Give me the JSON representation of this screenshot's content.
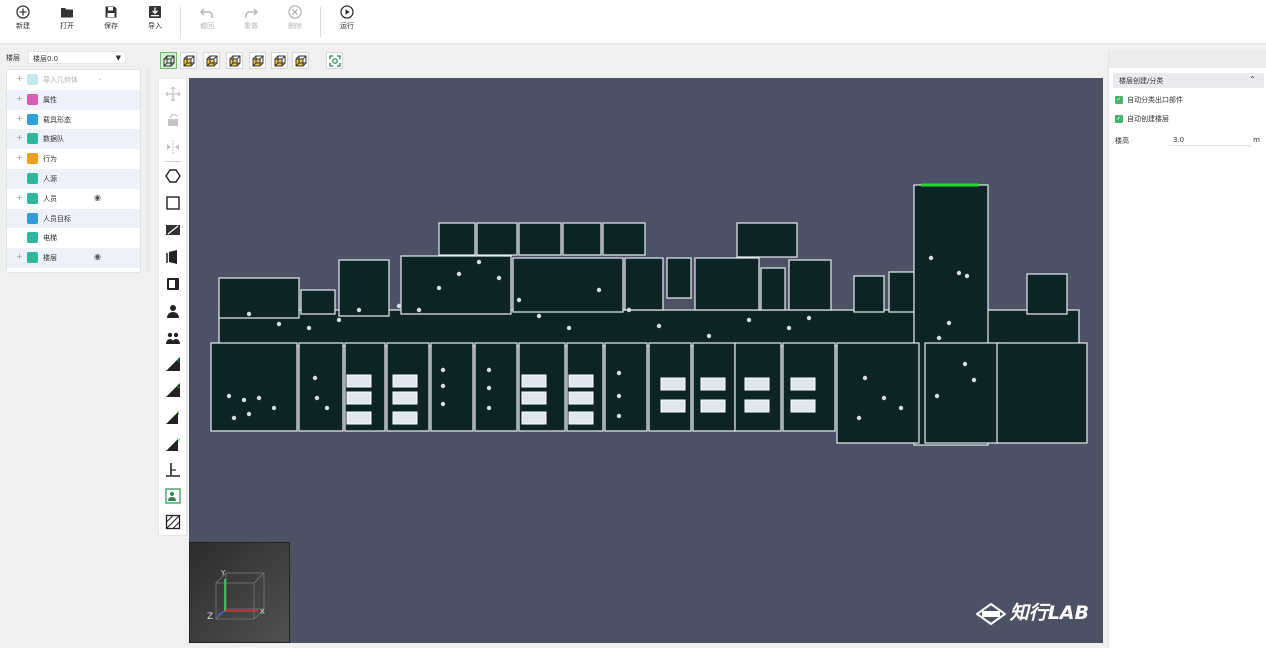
{
  "toolbar": {
    "new": {
      "label": "新建",
      "icon": "plus-circle-icon"
    },
    "open": {
      "label": "打开",
      "icon": "folder-icon"
    },
    "save": {
      "label": "保存",
      "icon": "floppy-icon"
    },
    "import": {
      "label": "导入",
      "icon": "import-icon"
    },
    "undo": {
      "label": "撤回",
      "icon": "undo-icon",
      "enabled": false
    },
    "redo": {
      "label": "重做",
      "icon": "redo-icon",
      "enabled": false
    },
    "delete": {
      "label": "删除",
      "icon": "delete-icon",
      "enabled": false
    },
    "run": {
      "label": "运行",
      "icon": "play-circle-icon"
    }
  },
  "floor": {
    "label": "楼层",
    "selected": "楼层0.0"
  },
  "tree": {
    "items": [
      {
        "label": "导入几何体",
        "icon": "geometry-icon",
        "color": "#6fc4d8",
        "expandable": true,
        "dimmed": true,
        "chevron": true
      },
      {
        "label": "属性",
        "icon": "attribute-icon",
        "color": "#d65db1",
        "expandable": true
      },
      {
        "label": "载具形态",
        "icon": "vehicle-icon",
        "color": "#2f9fd6",
        "expandable": true
      },
      {
        "label": "数据队",
        "icon": "data-icon",
        "color": "#2fb7a0",
        "expandable": true
      },
      {
        "label": "行为",
        "icon": "behavior-icon",
        "color": "#f0a020",
        "expandable": true
      },
      {
        "label": "人源",
        "icon": "source-icon",
        "color": "#2fb7a0",
        "expandable": false
      },
      {
        "label": "人员",
        "icon": "person-icon",
        "color": "#2fb7a0",
        "expandable": true,
        "eye": true
      },
      {
        "label": "人员目标",
        "icon": "target-icon",
        "color": "#2f9fd6",
        "expandable": false
      },
      {
        "label": "电梯",
        "icon": "elevator-icon",
        "color": "#2fb7a0",
        "expandable": false
      },
      {
        "label": "楼层",
        "icon": "floor-icon",
        "color": "#2fb7a0",
        "expandable": true,
        "eye": true
      }
    ]
  },
  "view_buttons": [
    "perspective-view-icon",
    "front-view-icon",
    "back-view-icon",
    "left-view-icon",
    "right-view-icon",
    "top-view-icon",
    "bottom-view-icon"
  ],
  "focus_button": "focus-view-icon",
  "tools": [
    "move-icon",
    "rotate-icon",
    "mirror-icon",
    "polygon-icon",
    "rectangle-icon",
    "line-wall-icon",
    "door-icon",
    "room-icon",
    "person-add-icon",
    "group-add-icon",
    "stairs-1-icon",
    "stairs-2-icon",
    "stairs-3-icon",
    "stairs-4-icon",
    "elevator-shaft-icon",
    "agent-target-icon",
    "hatch-icon"
  ],
  "axis": {
    "x": "X",
    "y": "Y",
    "z": "Z"
  },
  "logo": {
    "text": "知行LAB",
    "badge": "LAB"
  },
  "right_panel": {
    "section_title": "楼层创建/分类",
    "checks": [
      {
        "label": "自动分类出口部件",
        "checked": true
      },
      {
        "label": "自动创建楼层",
        "checked": true
      }
    ],
    "height_label": "楼高",
    "height_value": "3.0",
    "height_unit": "m"
  },
  "colors": {
    "viewport_bg": "#4d5166",
    "floor_fill": "#0d2424",
    "wall": "#e8ecef",
    "exit_highlight": "#23d832",
    "accent_green": "#45b36b"
  }
}
